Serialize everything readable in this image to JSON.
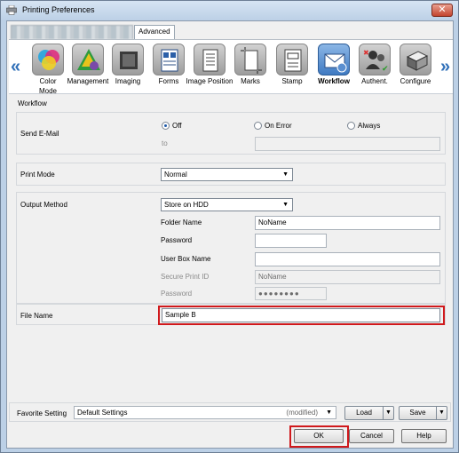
{
  "window": {
    "title": "Printing Preferences",
    "close_glyph": "✕"
  },
  "tabs": {
    "blurred_tab": "",
    "advanced": "Advanced"
  },
  "toolbar": {
    "left_chevron": "«",
    "right_chevron": "»",
    "items": [
      {
        "label1": "Color",
        "label2": "Mode",
        "icon": "color-mode-icon"
      },
      {
        "label1": "Management",
        "label2": "",
        "icon": "management-icon"
      },
      {
        "label1": "Imaging",
        "label2": "",
        "icon": "imaging-icon"
      },
      {
        "label1": "Forms",
        "label2": "",
        "icon": "forms-icon"
      },
      {
        "label1": "Image Position",
        "label2": "",
        "icon": "image-position-icon"
      },
      {
        "label1": "Marks",
        "label2": "",
        "icon": "marks-icon"
      },
      {
        "label1": "Stamp",
        "label2": "",
        "icon": "stamp-icon"
      },
      {
        "label1": "Workflow",
        "label2": "",
        "icon": "workflow-icon",
        "active": true
      },
      {
        "label1": "Authent.",
        "label2": "",
        "icon": "authentication-icon"
      },
      {
        "label1": "Configure",
        "label2": "",
        "icon": "configure-icon"
      }
    ]
  },
  "panel": {
    "title": "Workflow"
  },
  "send_email": {
    "label": "Send E-Mail",
    "options": [
      "Off",
      "On Error",
      "Always"
    ],
    "selected": "Off",
    "to_label": "to",
    "to_value": ""
  },
  "print_mode": {
    "label": "Print Mode",
    "value": "Normal"
  },
  "output_method": {
    "label": "Output Method",
    "value": "Store on HDD",
    "folder_name_label": "Folder Name",
    "folder_name_value": "NoName",
    "password_label": "Password",
    "password_value": "",
    "user_box_label": "User Box Name",
    "user_box_value": "",
    "secure_id_label": "Secure Print ID",
    "secure_id_value": "NoName",
    "secure_password_label": "Password",
    "secure_password_value": "●●●●●●●●"
  },
  "file_name": {
    "label": "File Name",
    "value": "Sample B"
  },
  "favorite": {
    "label": "Favorite Setting",
    "value": "Default Settings",
    "modified": "(modified)",
    "load": "Load",
    "save": "Save"
  },
  "buttons": {
    "ok": "OK",
    "cancel": "Cancel",
    "help": "Help"
  },
  "colors": {
    "highlight": "#d0191c",
    "active_tab": "#3f7ac2"
  }
}
